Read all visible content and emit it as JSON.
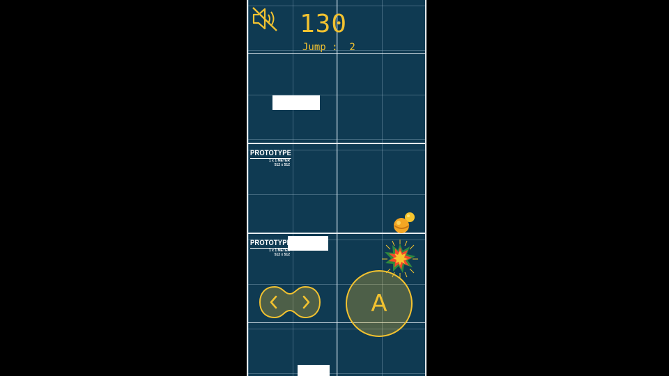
{
  "hud": {
    "score": "130",
    "jump_label": "Jump :  2",
    "mute_icon": "speaker-muted-icon"
  },
  "tiles": [
    {
      "prototype_title": "PROTOTYPE",
      "line1": "1 x 1 METER",
      "line2": "512 x 512"
    },
    {
      "prototype_title": "PROTOTYPE",
      "line1": "1 x 1 METER",
      "line2": "512 x 512"
    }
  ],
  "controls": {
    "a_button_label": "A",
    "dpad_left_icon": "chevron-left-icon",
    "dpad_right_icon": "chevron-right-icon"
  },
  "colors": {
    "accent": "#f2c230",
    "background": "#0f3a52",
    "platform": "#ffffff",
    "page_bg": "#000000"
  }
}
